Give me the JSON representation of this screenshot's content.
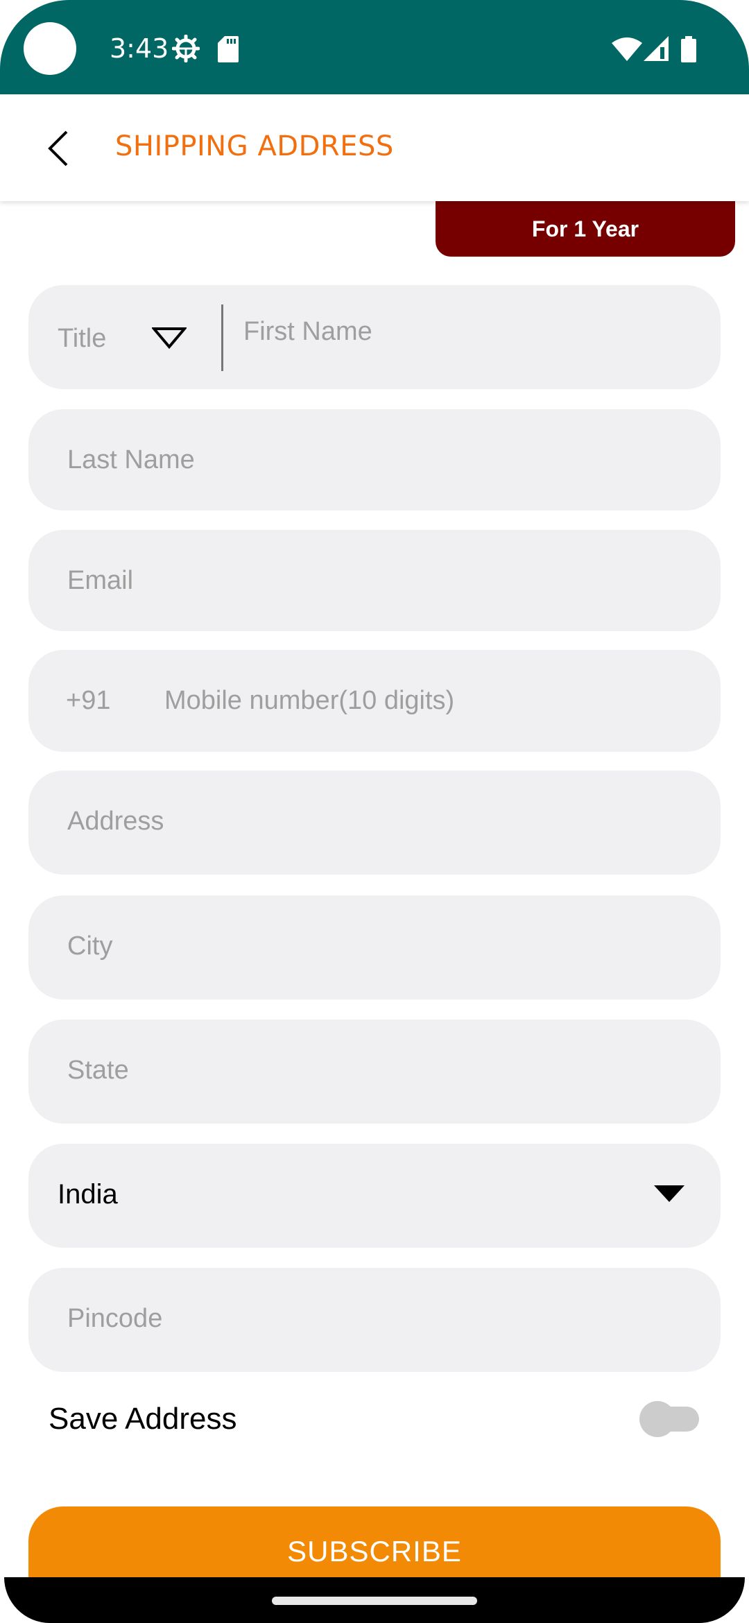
{
  "status_bar": {
    "time": "3:43",
    "left_icons": [
      "settings-gear-icon",
      "sd-card-icon"
    ],
    "right_icons": [
      "wifi-icon",
      "cell-signal-icon",
      "battery-icon"
    ],
    "background_color": "#006764"
  },
  "app_bar": {
    "back_icon": "chevron-left-icon",
    "title": "SHIPPING ADDRESS",
    "title_color": "#f26f10"
  },
  "plan_badge": {
    "label": "For 1 Year",
    "color": "#760000"
  },
  "form": {
    "title_select": {
      "placeholder": "Title",
      "icon": "triangle-down-outline-icon"
    },
    "first_name": {
      "value": "",
      "placeholder": "First Name"
    },
    "last_name": {
      "value": "",
      "placeholder": "Last Name"
    },
    "email": {
      "value": "",
      "placeholder": "Email"
    },
    "mobile": {
      "country_code": "+91",
      "value": "",
      "placeholder": "Mobile number(10 digits)"
    },
    "address": {
      "value": "",
      "placeholder": "Address"
    },
    "city": {
      "value": "",
      "placeholder": "City"
    },
    "state": {
      "value": "",
      "placeholder": "State"
    },
    "country": {
      "selected": "India",
      "icon": "triangle-down-filled-icon"
    },
    "pincode": {
      "value": "",
      "placeholder": "Pincode"
    },
    "save_address": {
      "label": "Save Address",
      "checked": false
    }
  },
  "subscribe_button": {
    "label": "SUBSCRIBE",
    "color": "#f28a06"
  }
}
